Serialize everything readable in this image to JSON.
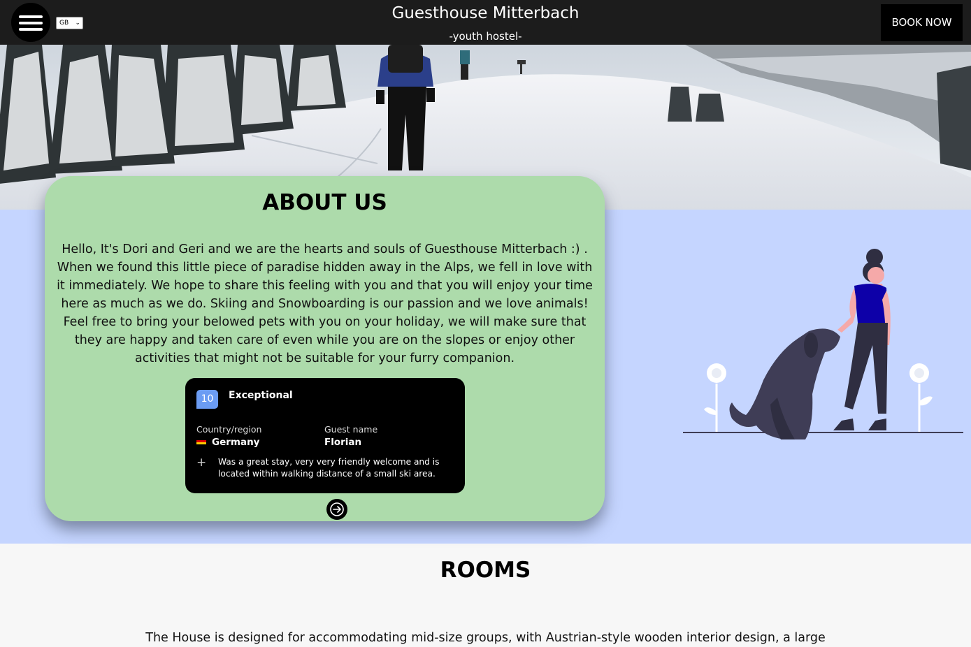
{
  "header": {
    "language": "GB",
    "title": "Guesthouse Mitterbach",
    "subtitle": "-youth hostel-",
    "book_button": "BOOK NOW"
  },
  "about": {
    "title": "ABOUT US",
    "text": "Hello, It's Dori and Geri and we are the hearts and souls of Guesthouse Mitterbach :) . When we found this little piece of paradise hidden away in the Alps, we fell in love with it immediately. We hope to share this feeling with you and that you will enjoy your time here as much as we do. Skiing and Snowboarding is our passion and we love animals! Feel free to bring your belowed pets with you on your holiday, we will make sure that they are happy and taken care of even while you are on the slopes or enjoy other activities that might not be suitable for your furry companion.",
    "review": {
      "score": "10",
      "score_label": "Exceptional",
      "country_label": "Country/region",
      "country": "Germany",
      "guest_label": "Guest name",
      "guest": "Florian",
      "comment": "Was a great stay, very very friendly welcome and is located within walking distance of a small ski area."
    }
  },
  "rooms": {
    "title": "ROOMS",
    "text": "The House is designed for accommodating mid-size groups, with Austrian-style wooden interior design, a large"
  },
  "colors": {
    "header_bg": "#1c1c1c",
    "about_bg": "#c5d5ff",
    "card_bg": "#addbab",
    "accent_blue": "#6b9cf3",
    "figure_top": "#0d00a8"
  }
}
